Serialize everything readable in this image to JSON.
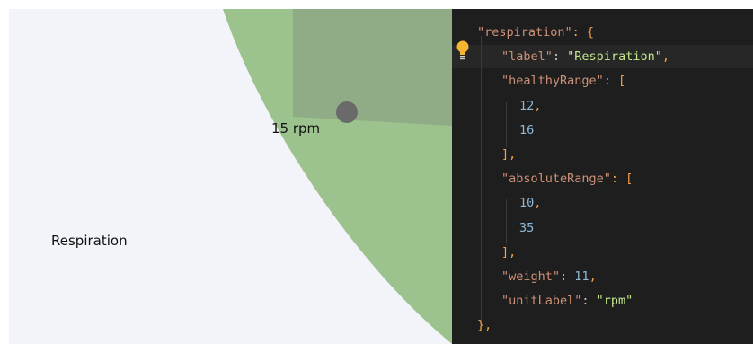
{
  "chart": {
    "axis_label": "Respiration",
    "value_label": "15 rpm",
    "colors": {
      "background": "#f2f4f9",
      "healthy_fill": "#9cc28e",
      "value_fill": "#8fac86",
      "point": "#6a6a6a"
    }
  },
  "editor": {
    "icon": "lightbulb-icon",
    "lines": [
      {
        "indent": 28,
        "parts": [
          {
            "t": "\"respiration\"",
            "c": "k"
          },
          {
            "t": ": {",
            "c": "o"
          }
        ]
      },
      {
        "indent": 55,
        "parts": [
          {
            "t": "\"label\"",
            "c": "k"
          },
          {
            "t": ": ",
            "c": "p"
          },
          {
            "t": "\"Respiration\"",
            "c": "s"
          },
          {
            "t": ",",
            "c": "o"
          }
        ]
      },
      {
        "indent": 55,
        "parts": [
          {
            "t": "\"healthyRange\"",
            "c": "k"
          },
          {
            "t": ": [",
            "c": "o"
          }
        ]
      },
      {
        "indent": 75,
        "parts": [
          {
            "t": "12",
            "c": "n"
          },
          {
            "t": ",",
            "c": "o"
          }
        ]
      },
      {
        "indent": 75,
        "parts": [
          {
            "t": "16",
            "c": "n"
          }
        ]
      },
      {
        "indent": 55,
        "parts": [
          {
            "t": "],",
            "c": "o"
          }
        ]
      },
      {
        "indent": 55,
        "parts": [
          {
            "t": "\"absoluteRange\"",
            "c": "k"
          },
          {
            "t": ": [",
            "c": "o"
          }
        ]
      },
      {
        "indent": 75,
        "parts": [
          {
            "t": "10",
            "c": "n"
          },
          {
            "t": ",",
            "c": "o"
          }
        ]
      },
      {
        "indent": 75,
        "parts": [
          {
            "t": "35",
            "c": "n"
          }
        ]
      },
      {
        "indent": 55,
        "parts": [
          {
            "t": "],",
            "c": "o"
          }
        ]
      },
      {
        "indent": 55,
        "parts": [
          {
            "t": "\"weight\"",
            "c": "k"
          },
          {
            "t": ": ",
            "c": "p"
          },
          {
            "t": "11",
            "c": "n"
          },
          {
            "t": ",",
            "c": "o"
          }
        ]
      },
      {
        "indent": 55,
        "parts": [
          {
            "t": "\"unitLabel\"",
            "c": "k"
          },
          {
            "t": ": ",
            "c": "p"
          },
          {
            "t": "\"rpm\"",
            "c": "s"
          }
        ]
      },
      {
        "indent": 28,
        "parts": [
          {
            "t": "},",
            "c": "o"
          }
        ]
      }
    ]
  }
}
